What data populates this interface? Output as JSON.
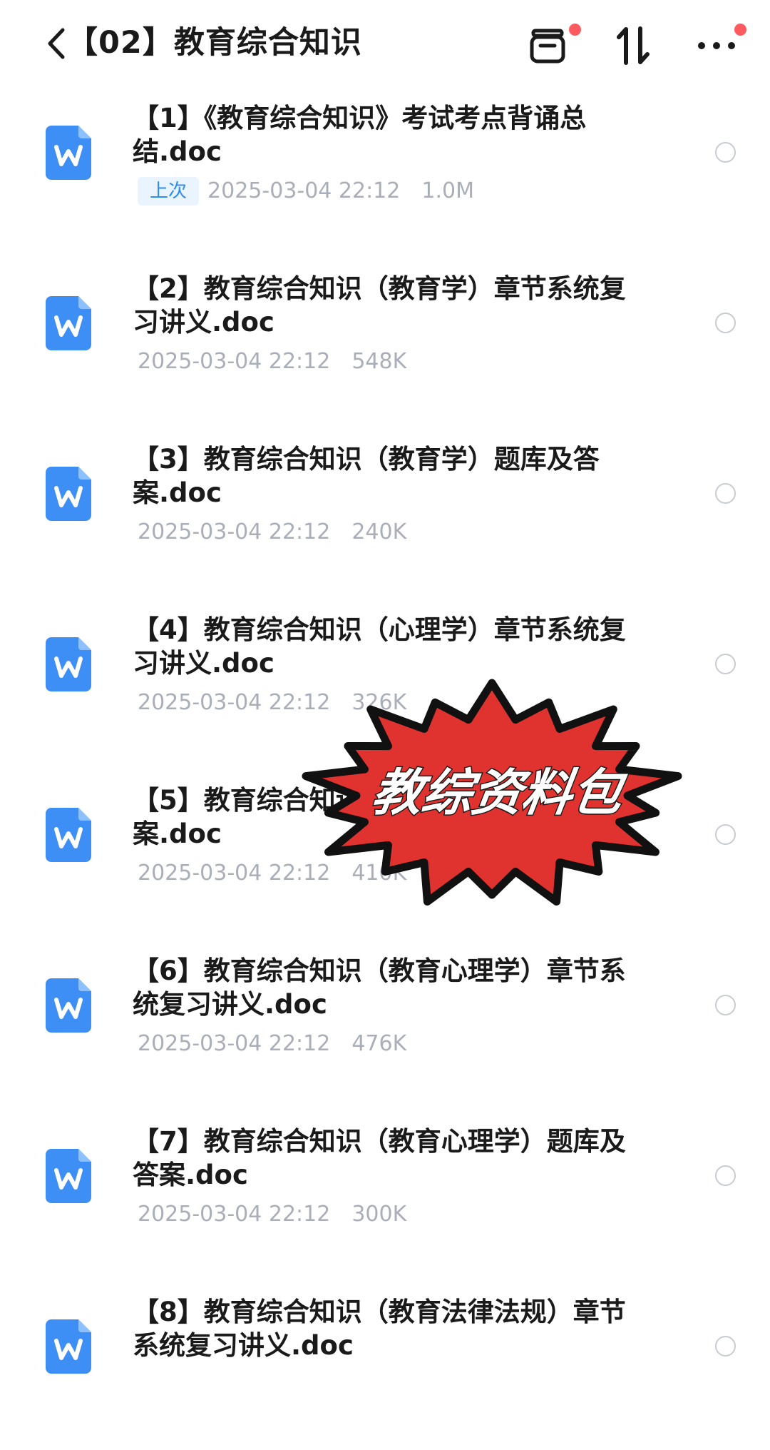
{
  "header": {
    "title": "【02】教育综合知识",
    "back_icon": "chevron-left-icon",
    "icons": [
      "archive-box-icon",
      "sort-arrows-icon",
      "more-dots-icon"
    ],
    "notification_dot_color": "#ff5a5f"
  },
  "files": [
    {
      "name": "【1】《教育综合知识》考试考点背诵总结.doc",
      "badge": "上次",
      "date": "2025-03-04 22:12",
      "size": "1.0M"
    },
    {
      "name": "【2】教育综合知识（教育学）章节系统复习讲义.doc",
      "badge": "",
      "date": "2025-03-04 22:12",
      "size": "548K"
    },
    {
      "name": "【3】教育综合知识（教育学）题库及答案.doc",
      "badge": "",
      "date": "2025-03-04 22:12",
      "size": "240K"
    },
    {
      "name": "【4】教育综合知识（心理学）章节系统复习讲义.doc",
      "badge": "",
      "date": "2025-03-04 22:12",
      "size": "326K"
    },
    {
      "name": "【5】教育综合知识（心理学）题库及答案.doc",
      "badge": "",
      "date": "2025-03-04 22:12",
      "size": "410K"
    },
    {
      "name": "【6】教育综合知识（教育心理学）章节系统复习讲义.doc",
      "badge": "",
      "date": "2025-03-04 22:12",
      "size": "476K"
    },
    {
      "name": "【7】教育综合知识（教育心理学）题库及答案.doc",
      "badge": "",
      "date": "2025-03-04 22:12",
      "size": "300K"
    },
    {
      "name": "【8】教育综合知识（教育法律法规）章节系统复习讲义.doc",
      "badge": "",
      "date": "",
      "size": ""
    }
  ],
  "file_icon": "word-doc-icon",
  "file_icon_color": "#3d8ef5",
  "overlay": {
    "text": "教综资料包",
    "burst_color": "#e0332f"
  }
}
